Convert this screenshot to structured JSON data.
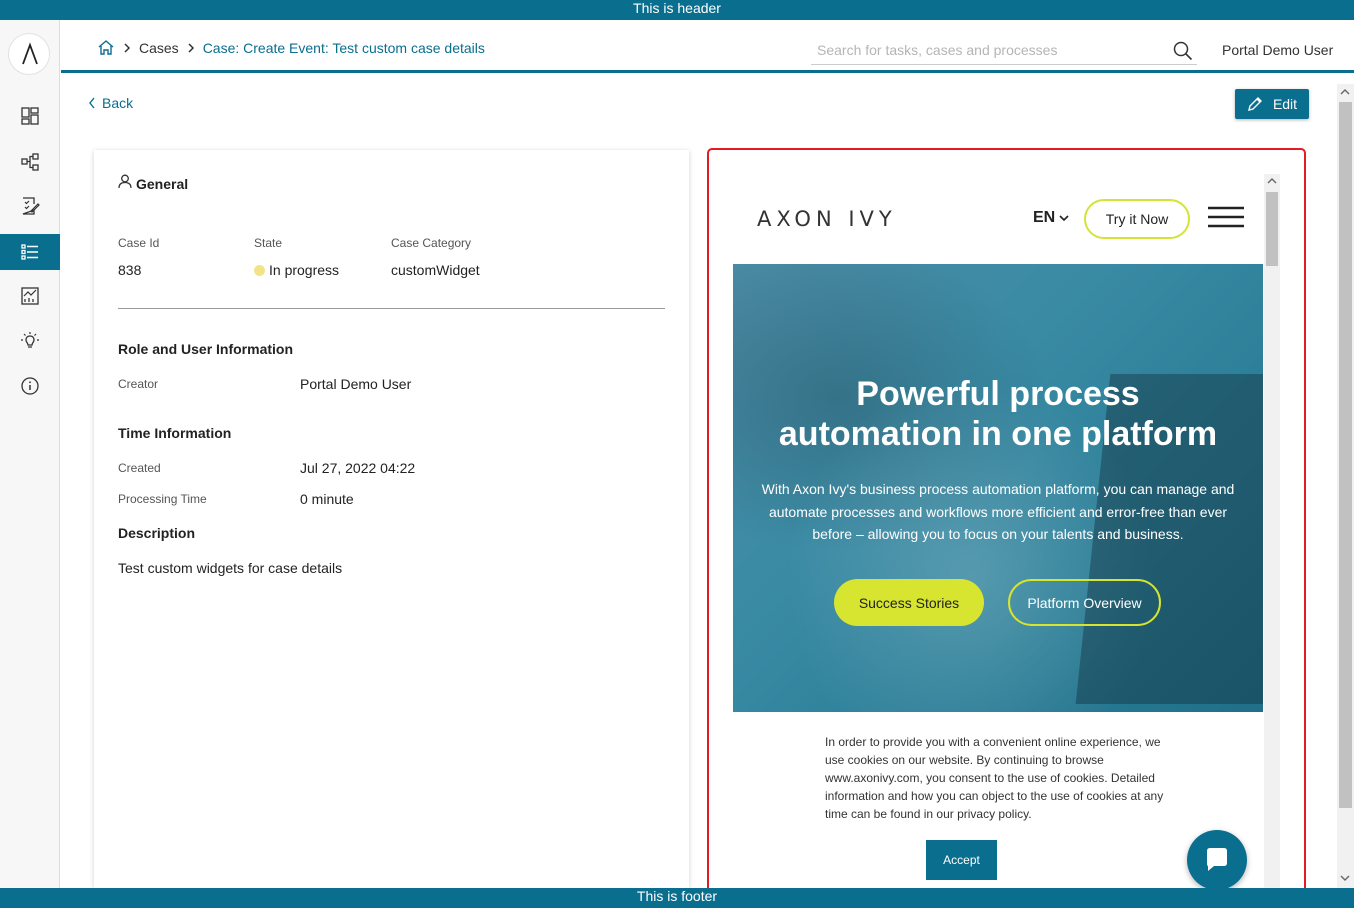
{
  "header_banner": "This is header",
  "footer_banner": "This is footer",
  "sidebar": {
    "items": [
      {
        "icon": "dashboard-icon"
      },
      {
        "icon": "processes-icon"
      },
      {
        "icon": "tasks-icon"
      },
      {
        "icon": "cases-icon",
        "active": true
      },
      {
        "icon": "statistics-icon"
      },
      {
        "icon": "ideas-icon"
      },
      {
        "icon": "info-icon"
      }
    ]
  },
  "breadcrumb": {
    "cases": "Cases",
    "current": "Case: Create Event: Test custom case details"
  },
  "search": {
    "placeholder": "Search for tasks, cases and processes",
    "value": ""
  },
  "user": {
    "name": "Portal Demo User"
  },
  "back_label": "Back",
  "edit_label": "Edit",
  "general": {
    "title": "General",
    "case_id_label": "Case Id",
    "case_id": "838",
    "state_label": "State",
    "state": "In progress",
    "state_color": "#f2e38a",
    "category_label": "Case Category",
    "category": "customWidget",
    "role_title": "Role and User Information",
    "creator_label": "Creator",
    "creator": "Portal Demo User",
    "time_title": "Time Information",
    "created_label": "Created",
    "created": "Jul 27, 2022 04:22",
    "processing_label": "Processing Time",
    "processing": "0 minute",
    "description_title": "Description",
    "description": "Test custom widgets for case details"
  },
  "widget": {
    "logo": "AXON IVY",
    "lang": "EN",
    "try_label": "Try it Now",
    "hero_title_line1": "Powerful process",
    "hero_title_line2": "automation in one platform",
    "hero_text": "With Axon Ivy's business process automation platform, you can manage and automate processes and workflows more efficient and error-free than ever before – allowing you to focus on your talents and business.",
    "btn_success": "Success Stories",
    "btn_platform": "Platform Overview",
    "cookie_text": "In order to provide you with a convenient online experience, we use cookies on our website. By continuing to browse www.axonivy.com, you consent to the use of cookies. Detailed information and how you can object to the use of cookies at any time can be found in our privacy policy.",
    "accept_label": "Accept",
    "accent_color": "#d7e530",
    "border_color": "#e31b23"
  },
  "colors": {
    "primary": "#0a6e8f"
  }
}
